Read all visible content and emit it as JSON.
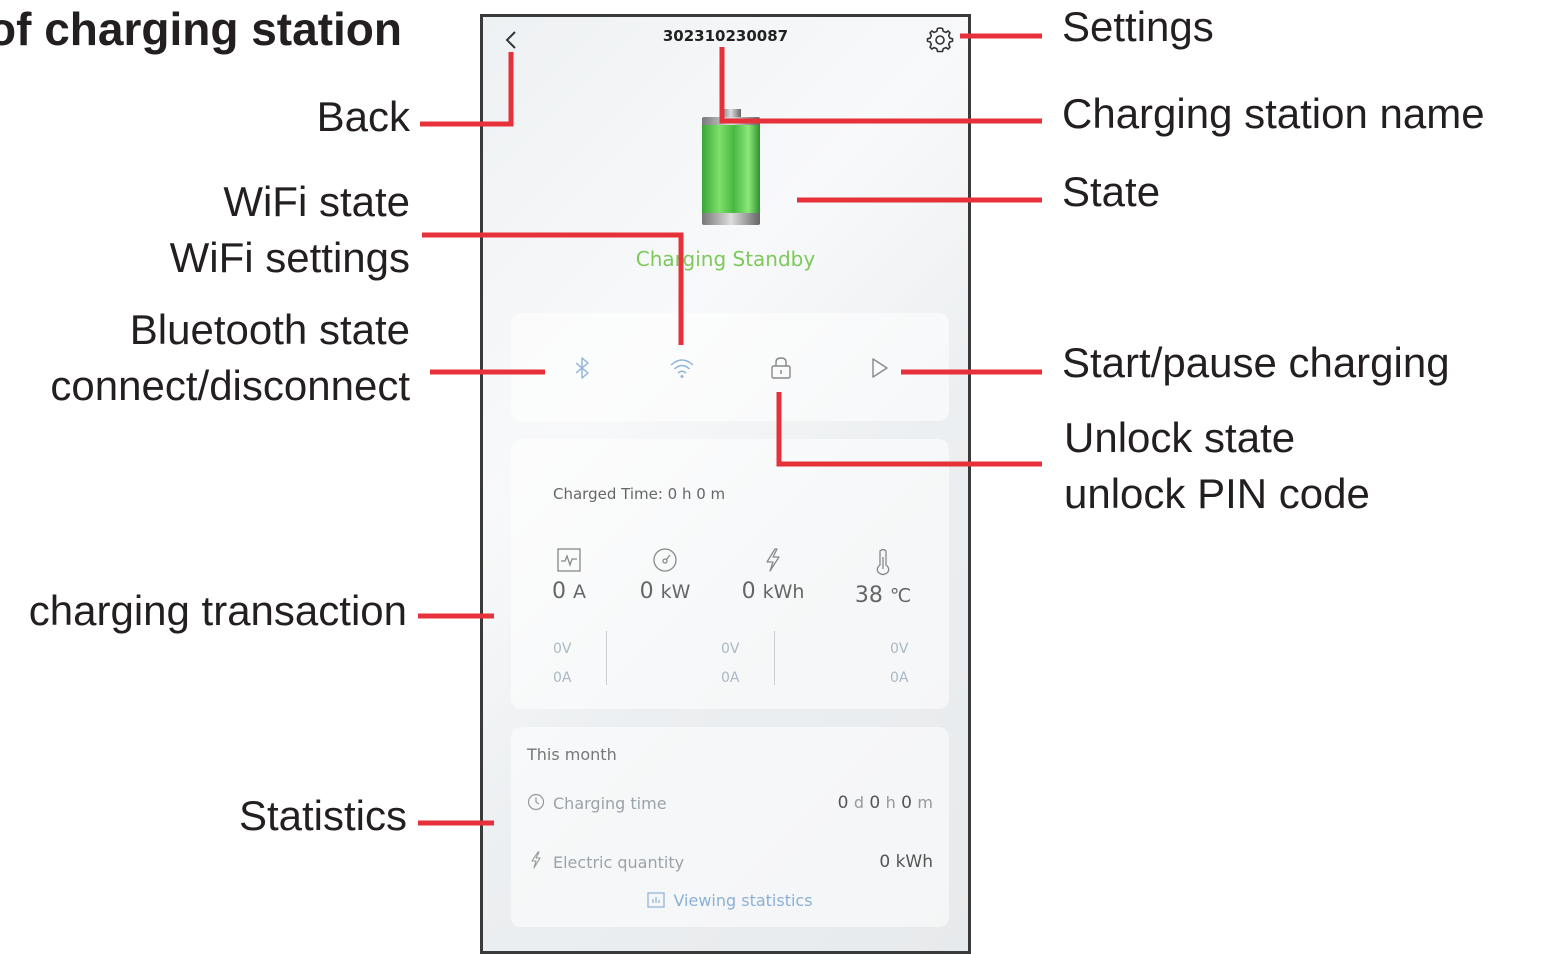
{
  "heading": "of charging station",
  "labels": {
    "back": "Back",
    "wifi_state": "WiFi state",
    "wifi_settings": "WiFi settings",
    "bluetooth_state": "Bluetooth state",
    "bluetooth_connect": "connect/disconnect",
    "charging_transaction": "charging transaction",
    "statistics": "Statistics",
    "settings": "Settings",
    "station_name": "Charging station name",
    "state": "State",
    "start_pause": "Start/pause charging",
    "unlock_state": "Unlock state",
    "unlock_pin": "unlock PIN code"
  },
  "colors": {
    "leader": "#e6303a",
    "state_green": "#7dc95a",
    "link_blue": "#8ab0d8",
    "icon_blue": "#8fb4dc"
  },
  "phone": {
    "station_id": "302310230087",
    "back_icon": "chevron-left-icon",
    "settings_icon": "gear-icon",
    "state_text": "Charging Standby",
    "controls": [
      "bluetooth-icon",
      "wifi-icon",
      "lock-icon",
      "play-icon"
    ],
    "transaction": {
      "charged_time": "Charged Time: 0 h 0 m",
      "metrics": [
        {
          "icon": "pulse-icon",
          "value": "0",
          "unit": "A"
        },
        {
          "icon": "gauge-icon",
          "value": "0",
          "unit": "kW"
        },
        {
          "icon": "lightning-icon",
          "value": "0",
          "unit": "kWh"
        },
        {
          "icon": "thermometer-icon",
          "value": "38",
          "unit": "℃"
        }
      ],
      "phases": [
        {
          "voltage": "0V",
          "current": "0A"
        },
        {
          "voltage": "0V",
          "current": "0A"
        },
        {
          "voltage": "0V",
          "current": "0A"
        }
      ]
    },
    "stats": {
      "title": "This month",
      "charging_time_label": "Charging time",
      "charging_time": {
        "d": "0",
        "h": "0",
        "m": "0",
        "d_unit": "d",
        "h_unit": "h",
        "m_unit": "m"
      },
      "electric_quantity_label": "Electric quantity",
      "electric_quantity": "0 kWh",
      "view_link": "Viewing statistics"
    }
  }
}
